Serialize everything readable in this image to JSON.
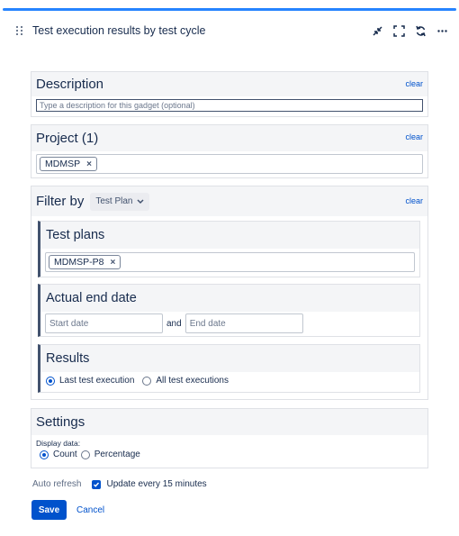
{
  "gadget": {
    "title": "Test execution results by test cycle",
    "icons": [
      "collapse-icon",
      "fullscreen-icon",
      "refresh-icon",
      "more-icon"
    ]
  },
  "description": {
    "title": "Description",
    "clear": "clear",
    "placeholder": "Type a description for this gadget (optional)"
  },
  "project": {
    "title": "Project (1)",
    "clear": "clear",
    "tags": [
      "MDMSP"
    ]
  },
  "filter": {
    "title": "Filter by",
    "dropdown_value": "Test Plan",
    "clear": "clear",
    "test_plans": {
      "title": "Test plans",
      "tags": [
        "MDMSP-P8"
      ]
    },
    "actual_end_date": {
      "title": "Actual end date",
      "start_placeholder": "Start date",
      "and_text": "and",
      "end_placeholder": "End date"
    },
    "results": {
      "title": "Results",
      "options": [
        "Last test execution",
        "All test executions"
      ],
      "selected": "Last test execution"
    }
  },
  "settings": {
    "title": "Settings",
    "display_label": "Display data:",
    "options": [
      "Count",
      "Percentage"
    ],
    "selected": "Count"
  },
  "auto_refresh": {
    "label": "Auto refresh",
    "checkbox_label": "Update every 15 minutes",
    "checked": true
  },
  "actions": {
    "save": "Save",
    "cancel": "Cancel"
  },
  "colors": {
    "accent": "#0052cc",
    "top_bar": "#2684ff",
    "section_header_bg": "#f4f5f7"
  }
}
